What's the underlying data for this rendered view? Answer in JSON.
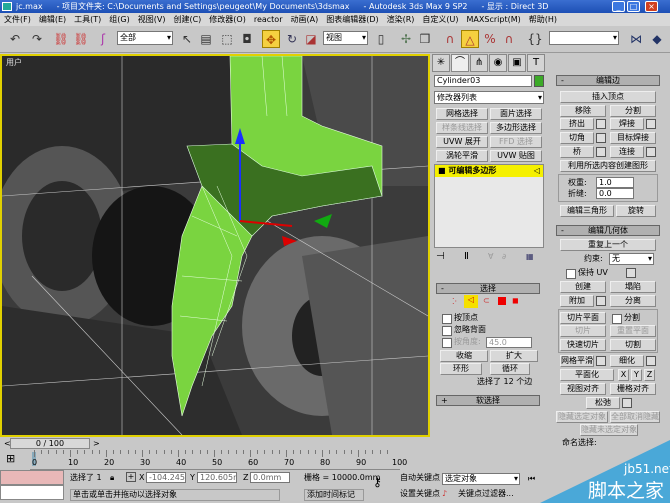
{
  "title": {
    "file": "jc.max",
    "project": "- 项目文件夹: C:\\Documents and Settings\\peugeot\\My Documents\\3dsmax",
    "app": "- Autodesk 3ds Max 9 SP2",
    "display": "- 显示 : Direct 3D"
  },
  "menu": [
    "文件(F)",
    "编辑(E)",
    "工具(T)",
    "组(G)",
    "视图(V)",
    "创建(C)",
    "修改器(O)",
    "reactor",
    "动画(A)",
    "图表编辑器(D)",
    "渲染(R)",
    "自定义(U)",
    "MAXScript(M)",
    "帮助(H)"
  ],
  "toolbar": {
    "selection_filter": "全部",
    "reference_coord": "视图",
    "named_selection": ""
  },
  "viewport": {
    "label": "用户"
  },
  "panel": {
    "object_name": "Cylinder03",
    "object_color": "#3caa28",
    "modifier_list": "修改器列表",
    "mod_buttons": [
      "网格选择",
      "面片选择",
      "样条线选择",
      "多边形选择",
      "UVW 展开",
      "FFD 选择",
      "涡轮平滑",
      "UVW 贴图"
    ],
    "stack_item": "可编辑多边形",
    "selection": {
      "title": "选择",
      "by_vertex": "按顶点",
      "ignore_backfacing": "忽略背面",
      "by_angle": "按角度:",
      "angle_value": "45.0",
      "shrink": "收缩",
      "grow": "扩大",
      "ring": "环形",
      "loop": "循环",
      "status": "选择了 12 个边"
    },
    "soft_selection": "软选择",
    "edit_edges": {
      "title": "编辑边",
      "insert_vertex": "插入顶点",
      "remove": "移除",
      "split": "分割",
      "extrude": "挤出",
      "weld": "焊接",
      "chamfer": "切角",
      "target_weld": "目标焊接",
      "bridge": "桥",
      "connect": "连接",
      "create_shape": "利用所选内容创建图形",
      "weight_label": "权重:",
      "weight": "1.0",
      "crease_label": "折缝:",
      "crease": "0.0",
      "edit_tri": "编辑三角形",
      "turn": "旋转"
    },
    "edit_geometry": {
      "title": "编辑几何体",
      "repeat_last": "重复上一个",
      "constraint_label": "约束:",
      "constraint": "无",
      "preserve_uv": "保持 UV",
      "create": "创建",
      "collapse": "塌陷",
      "attach": "附加",
      "detach": "分离",
      "slice_plane": "切片平面",
      "split": "分割",
      "slice": "切片",
      "reset_plane": "重置平面",
      "quickslice": "快速切片",
      "cut": "切割",
      "meshsmooth": "网格平滑",
      "tessellate": "细化",
      "make_planar": "平面化",
      "x": "X",
      "y": "Y",
      "z": "Z",
      "view_align": "视图对齐",
      "grid_align": "栅格对齐",
      "relax": "松弛",
      "hide_selected": "隐藏选定对象",
      "unhide_all": "全部取消隐藏",
      "hide_unselected": "隐藏未选定对象",
      "named_sel": "命名选择:"
    }
  },
  "timeline": {
    "frame": "0 / 100",
    "ticks": [
      "0",
      "10",
      "20",
      "30",
      "40",
      "50",
      "60",
      "70",
      "80",
      "90",
      "100"
    ]
  },
  "status": {
    "selected": "选择了 1",
    "x_label": "X",
    "x": "-104.245r",
    "y_label": "Y",
    "y": "120.605mr",
    "z_label": "Z",
    "z": "0.0mm",
    "grid": "栅格 = 10000.0mm",
    "prompt": "单击或单击并拖动以选择对象",
    "add_time_tag": "添加时间标记",
    "auto_key": "自动关键点",
    "set_key": "设置关键点",
    "key_mode": "选定对象",
    "key_filters": "关键点过滤器..."
  },
  "watermark": {
    "url": "jb51.net",
    "name": "脚本之家"
  }
}
